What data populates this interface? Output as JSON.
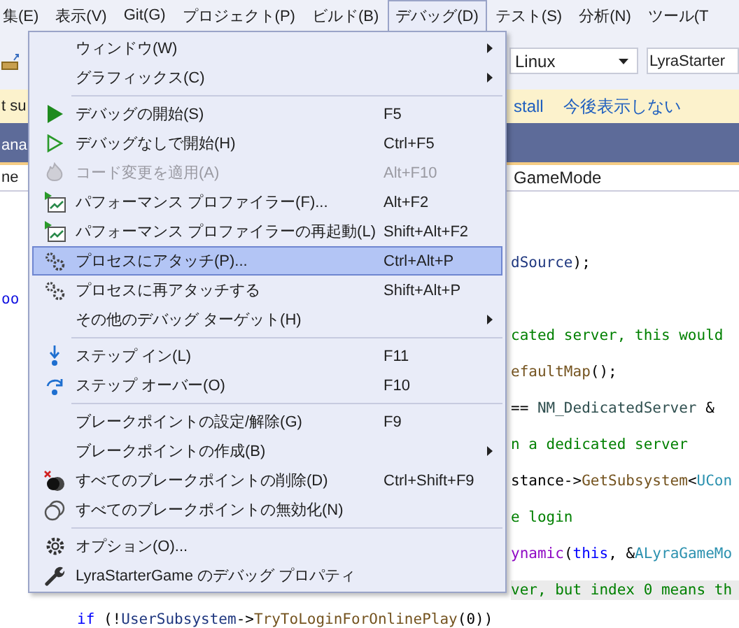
{
  "menubar": [
    {
      "label": "集(E)",
      "selected": false
    },
    {
      "label": "表示(V)",
      "selected": false
    },
    {
      "label": "Git(G)",
      "selected": false
    },
    {
      "label": "プロジェクト(P)",
      "selected": false
    },
    {
      "label": "ビルド(B)",
      "selected": false
    },
    {
      "label": "デバッグ(D)",
      "selected": true
    },
    {
      "label": "テスト(S)",
      "selected": false
    },
    {
      "label": "分析(N)",
      "selected": false
    },
    {
      "label": "ツール(T",
      "selected": false
    }
  ],
  "toolbar": {
    "platform_combo": "Linux",
    "project_combo": "LyraStarter"
  },
  "infobar": {
    "text": "t su",
    "links": [
      "stall",
      "今後表示しない"
    ]
  },
  "tab_strip": {
    "tab": "ana"
  },
  "navbar": {
    "left": "ne",
    "right": "GameMode"
  },
  "code": {
    "lines": [
      {
        "segments": [
          {
            "text": "dSource",
            "kind": "param"
          },
          {
            "text": ");",
            "kind": "plain"
          }
        ],
        "highlighted": false
      },
      {
        "gutter": "oo"
      },
      {
        "segments": [
          {
            "text": "cated server, this would",
            "kind": "comment"
          }
        ],
        "highlighted": false
      },
      {
        "segments": [
          {
            "text": "efaultMap",
            "kind": "func"
          },
          {
            "text": "();",
            "kind": "plain"
          }
        ],
        "highlighted": false
      },
      {
        "segments": [
          {
            "text": "== ",
            "kind": "plain"
          },
          {
            "text": "NM_DedicatedServer",
            "kind": "enum"
          },
          {
            "text": " &",
            "kind": "plain"
          }
        ],
        "highlighted": false
      },
      {
        "segments": [
          {
            "text": "n a dedicated server",
            "kind": "comment"
          }
        ],
        "highlighted": false
      },
      {
        "segments": [
          {
            "text": "stance->",
            "kind": "plain"
          },
          {
            "text": "GetSubsystem",
            "kind": "func"
          },
          {
            "text": "<",
            "kind": "plain"
          },
          {
            "text": "UCon",
            "kind": "class"
          }
        ],
        "highlighted": false
      },
      {
        "segments": [
          {
            "text": "e login",
            "kind": "comment"
          }
        ],
        "highlighted": false
      },
      {
        "segments": [
          {
            "text": "ynamic",
            "kind": "macro"
          },
          {
            "text": "(",
            "kind": "plain"
          },
          {
            "text": "this",
            "kind": "keyword"
          },
          {
            "text": ", &",
            "kind": "plain"
          },
          {
            "text": "ALyraGameMo",
            "kind": "class"
          }
        ],
        "highlighted": false
      },
      {
        "segments": [
          {
            "text": "ver, but index 0 means th",
            "kind": "comment"
          }
        ],
        "highlighted": true
      }
    ],
    "bottom_line": [
      {
        "text": "if",
        "kind": "keyword"
      },
      {
        "text": " (!",
        "kind": "plain"
      },
      {
        "text": "UserSubsystem",
        "kind": "param"
      },
      {
        "text": "->",
        "kind": "plain"
      },
      {
        "text": "TryToLoginForOnlinePlay",
        "kind": "func"
      },
      {
        "text": "(0))",
        "kind": "plain"
      }
    ]
  },
  "debug_menu": [
    {
      "kind": "plain",
      "label": "ウィンドウ(W)",
      "submenu": true,
      "disabled": false,
      "selected": false
    },
    {
      "kind": "plain",
      "label": "グラフィックス(C)",
      "submenu": true,
      "disabled": false,
      "selected": false
    },
    {
      "kind": "separator"
    },
    {
      "kind": "play",
      "label": "デバッグの開始(S)",
      "shortcut": "F5",
      "submenu": false,
      "disabled": false,
      "selected": false
    },
    {
      "kind": "play-outline",
      "label": "デバッグなしで開始(H)",
      "shortcut": "Ctrl+F5",
      "submenu": false,
      "disabled": false,
      "selected": false
    },
    {
      "kind": "flame",
      "label": "コード変更を適用(A)",
      "shortcut": "Alt+F10",
      "submenu": false,
      "disabled": true,
      "selected": false
    },
    {
      "kind": "profiler",
      "label": "パフォーマンス プロファイラー(F)...",
      "shortcut": "Alt+F2",
      "submenu": false,
      "disabled": false,
      "selected": false
    },
    {
      "kind": "profiler",
      "label": "パフォーマンス プロファイラーの再起動(L)",
      "shortcut": "Shift+Alt+F2",
      "submenu": false,
      "disabled": false,
      "selected": false
    },
    {
      "kind": "gears",
      "label": "プロセスにアタッチ(P)...",
      "shortcut": "Ctrl+Alt+P",
      "submenu": false,
      "disabled": false,
      "selected": true
    },
    {
      "kind": "gears",
      "label": "プロセスに再アタッチする",
      "shortcut": "Shift+Alt+P",
      "submenu": false,
      "disabled": false,
      "selected": false
    },
    {
      "kind": "plain",
      "label": "その他のデバッグ ターゲット(H)",
      "submenu": true,
      "disabled": false,
      "selected": false
    },
    {
      "kind": "separator"
    },
    {
      "kind": "step-into",
      "label": "ステップ イン(L)",
      "shortcut": "F11",
      "submenu": false,
      "disabled": false,
      "selected": false
    },
    {
      "kind": "step-over",
      "label": "ステップ オーバー(O)",
      "shortcut": "F10",
      "submenu": false,
      "disabled": false,
      "selected": false
    },
    {
      "kind": "separator"
    },
    {
      "kind": "plain",
      "label": "ブレークポイントの設定/解除(G)",
      "shortcut": "F9",
      "submenu": false,
      "disabled": false,
      "selected": false
    },
    {
      "kind": "plain",
      "label": "ブレークポイントの作成(B)",
      "submenu": true,
      "disabled": false,
      "selected": false
    },
    {
      "kind": "delete-breakpoints",
      "label": "すべてのブレークポイントの削除(D)",
      "shortcut": "Ctrl+Shift+F9",
      "submenu": false,
      "disabled": false,
      "selected": false
    },
    {
      "kind": "disable-breakpoints",
      "label": "すべてのブレークポイントの無効化(N)",
      "submenu": false,
      "disabled": false,
      "selected": false
    },
    {
      "kind": "separator"
    },
    {
      "kind": "gear",
      "label": "オプション(O)...",
      "submenu": false,
      "disabled": false,
      "selected": false
    },
    {
      "kind": "wrench",
      "label": "LyraStarterGame のデバッグ プロパティ",
      "submenu": false,
      "disabled": false,
      "selected": false
    }
  ]
}
